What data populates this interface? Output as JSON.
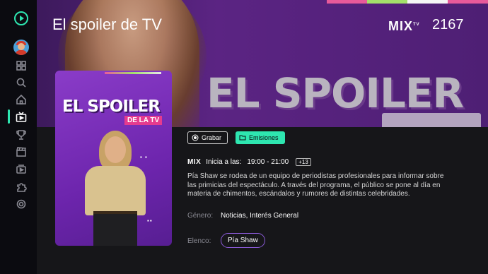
{
  "header": {
    "title": "El spoiler de TV",
    "channel_logo": "MIX",
    "channel_logo_suffix": "TV",
    "channel_number": "2167"
  },
  "hero": {
    "big_text": "EL SPOILER"
  },
  "poster": {
    "title": "EL SPOILER",
    "subtitle": "DE LA TV"
  },
  "sidebar": {
    "items": [
      {
        "name": "grid-icon"
      },
      {
        "name": "search-icon"
      },
      {
        "name": "home-icon"
      },
      {
        "name": "tv-icon",
        "active": true
      },
      {
        "name": "trophy-icon"
      },
      {
        "name": "clapperboard-icon"
      },
      {
        "name": "record-icon"
      },
      {
        "name": "puzzle-icon"
      },
      {
        "name": "settings-icon"
      }
    ]
  },
  "actions": {
    "record_label": "Grabar",
    "airings_label": "Emisiones"
  },
  "program": {
    "channel_logo": "MIX",
    "starts_label": "Inicia a las:",
    "time_range": "19:00  - 21:00",
    "rating": "+13",
    "description": "Pía Shaw se rodea de un equipo de periodistas profesionales para informar sobre las primicias del espectáculo. A través del programa, el público se pone al día en materia de chimentos, escándalos y rumores de distintas celebridades.",
    "genre_label": "Género:",
    "genre_value": "Noticias, Interés General",
    "cast_label": "Elenco:",
    "cast": [
      "Pía Shaw"
    ]
  },
  "colors": {
    "accent": "#2ee6b0",
    "hero_purple": "#5b2483",
    "poster_purple": "#6d25ad",
    "pink": "#e53b8e"
  }
}
